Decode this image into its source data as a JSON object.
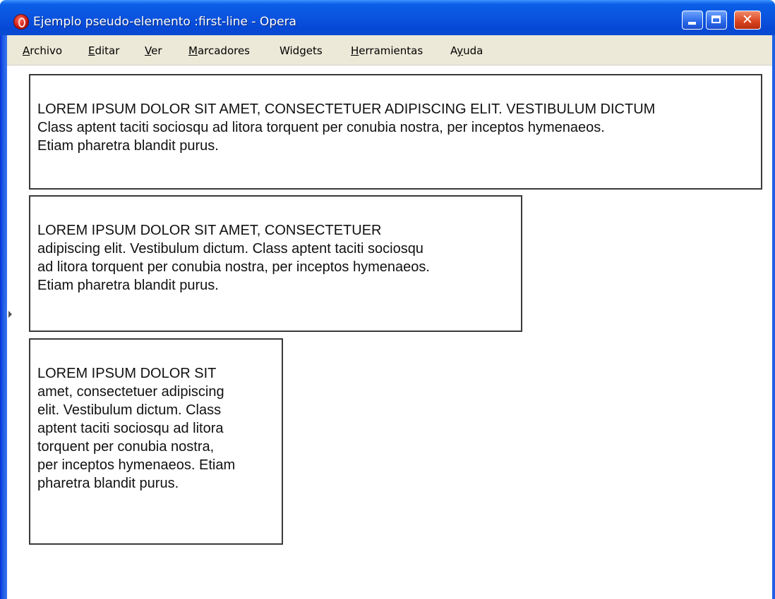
{
  "window": {
    "title": "Ejemplo pseudo-elemento :first-line - Opera",
    "buttons": {
      "minimize": "minimize",
      "maximize": "maximize",
      "close": "✕"
    }
  },
  "menu": [
    {
      "acc": "A",
      "rest": "rchivo"
    },
    {
      "acc": "E",
      "rest": "ditar"
    },
    {
      "acc": "V",
      "rest": "er"
    },
    {
      "acc": "M",
      "rest": "arcadores"
    },
    {
      "pre": "Wid",
      "acc": "g",
      "rest": "ets"
    },
    {
      "acc": "H",
      "rest": "erramientas"
    },
    {
      "pre": "A",
      "acc": "y",
      "rest": "uda"
    }
  ],
  "boxes": [
    {
      "lines": [
        "LOREM IPSUM DOLOR SIT AMET, CONSECTETUER ADIPISCING ELIT. VESTIBULUM DICTUM",
        "Class aptent taciti sociosqu ad litora torquent per conubia nostra, per inceptos hymenaeos.",
        "Etiam pharetra blandit purus."
      ]
    },
    {
      "lines": [
        "LOREM IPSUM DOLOR SIT AMET, CONSECTETUER",
        "adipiscing elit. Vestibulum dictum. Class aptent taciti sociosqu",
        "ad litora torquent per conubia nostra, per inceptos hymenaeos.",
        "Etiam pharetra blandit purus."
      ]
    },
    {
      "lines": [
        "LOREM IPSUM DOLOR SIT",
        "amet, consectetuer adipiscing",
        "elit. Vestibulum dictum. Class",
        "aptent taciti sociosqu ad litora",
        "torquent per conubia nostra,",
        "per inceptos hymenaeos. Etiam",
        "pharetra blandit purus."
      ]
    }
  ]
}
